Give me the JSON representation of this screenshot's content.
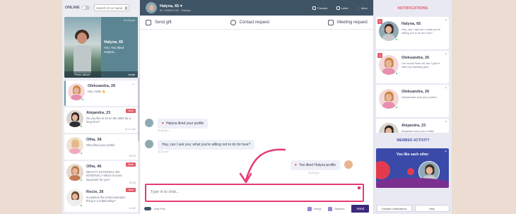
{
  "left": {
    "online_label": "ONLINE",
    "search_placeholder": "Search ID or name",
    "featured": {
      "name": "Halyna, 65",
      "time": "11:23 pm",
      "message": "You: You liked Halyna...",
      "photo_label": "Photo album",
      "invite_label": "Invite"
    },
    "cards": [
      {
        "name": "Oleksandra, 26",
        "message": "Hey, Hello 👋",
        "time": "",
        "new": false,
        "check": true
      },
      {
        "name": "Alejandra, 23",
        "message": "Do you like to sit on the toilet for a long time?",
        "time": "11:21 pm",
        "new": true,
        "new_label": "New"
      },
      {
        "name": "Olha, 38",
        "message": "Olha liked your profile",
        "time": "08:09",
        "new": false
      },
      {
        "name": "Olha, 46",
        "message": "BEAUTY EXTERNAL OR INTERNAL? Which is more important for you?",
        "time": "09:05",
        "new": true,
        "new_label": "New"
      },
      {
        "name": "Rocio, 26",
        "message": "Is passion the most important thing in a relationship?",
        "time": "20:32",
        "new": true,
        "new_label": "New"
      }
    ]
  },
  "chat": {
    "name": "Halyna, 65 ♥",
    "sub": "ID: 1345617134  ·  Odessa",
    "actions": [
      "Favorite",
      "Letter",
      "More"
    ],
    "tools": {
      "gift": "Send gift",
      "contact": "Contact request",
      "meeting": "Meeting request"
    },
    "messages": [
      {
        "text": "Halyna liked your profile",
        "time": "11:20 pm",
        "heart": true
      },
      {
        "text": "Hey, can I ask you: what you're willing not to do for love?",
        "time": "11:21 pm",
        "heart": false
      },
      {
        "text": "You liked Halyna profile",
        "time": "11:23 pm",
        "heart": true
      }
    ],
    "input_placeholder": "Type in to chat...",
    "bottom": {
      "toggle_label": "Add Pics",
      "emoji": "Emoji",
      "stickers": "Stickers",
      "send": "Send"
    }
  },
  "right": {
    "title": "NOTIFICATIONS",
    "notifications": [
      {
        "badge": "2",
        "name": "Halyna, 65",
        "message": "Hey, can I ask you: what you're willing not to do for love?"
      },
      {
        "badge": "1",
        "name": "Oleksandra, 26",
        "message": "I've found Pass off, but I give it with my chewing gum"
      },
      {
        "badge": "",
        "name": "Oleksandra, 26",
        "message": "Oleksandra sent you a letter",
        "time": ""
      },
      {
        "badge": "",
        "name": "Alejandra, 23",
        "message": "Alejandra sent you a letter"
      }
    ],
    "member_activity_title": "MEMBER ACTIVITY",
    "match_text": "You like each other",
    "bottom_buttons": [
      "Disable notifications",
      "Help"
    ]
  },
  "colors": {
    "accent": "#e83a72",
    "header": "#3f5566",
    "send": "#3b2a7a",
    "member_card": "#3a4aa8"
  }
}
